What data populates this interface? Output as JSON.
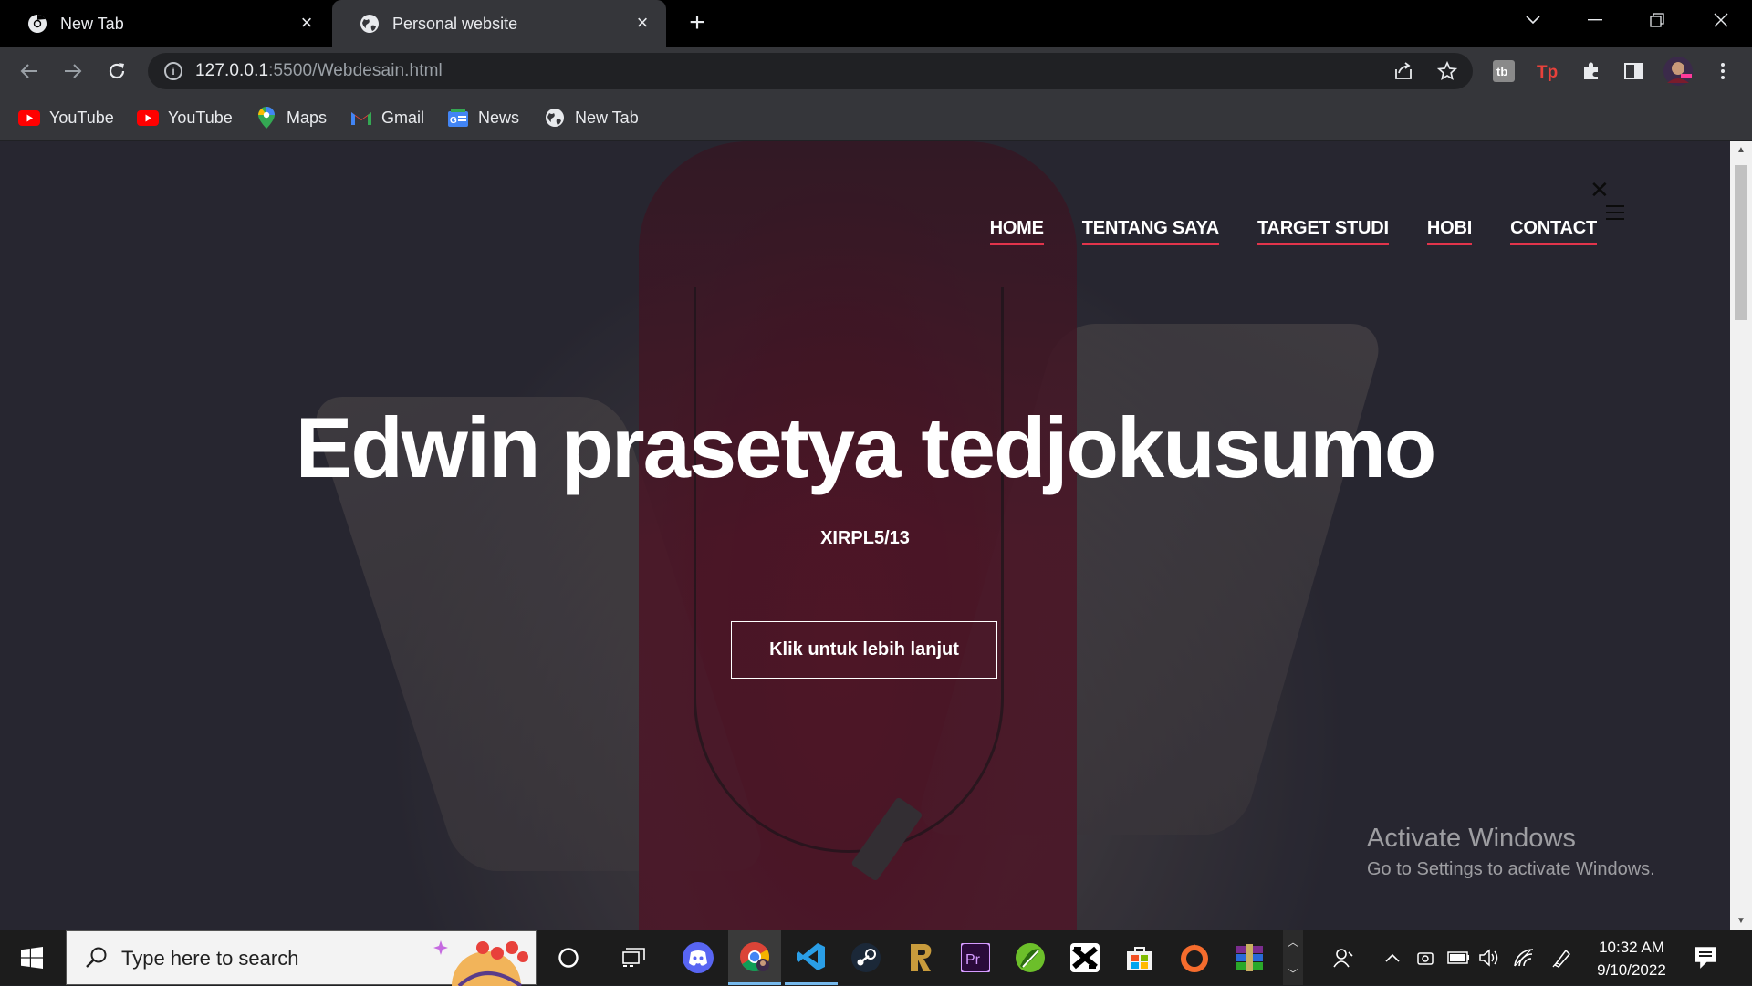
{
  "browser": {
    "tabs": [
      {
        "title": "New Tab",
        "active": false
      },
      {
        "title": "Personal website",
        "active": true
      }
    ],
    "url_host": "127.0.0.1",
    "url_rest": ":5500/Webdesain.html",
    "bookmarks": [
      "YouTube",
      "YouTube",
      "Maps",
      "Gmail",
      "News",
      "New Tab"
    ]
  },
  "site": {
    "nav": [
      "HOME",
      "TENTANG SAYA",
      "TARGET STUDI",
      "HOBI",
      "CONTACT"
    ],
    "close_glyph": "✕",
    "hero_title": "Edwin prasetya tedjokusumo",
    "hero_subtitle": "XIRPL5/13",
    "cta_label": "Klik untuk lebih lanjut"
  },
  "watermark": {
    "line1": "Activate Windows",
    "line2": "Go to Settings to activate Windows."
  },
  "taskbar": {
    "search_placeholder": "Type here to search",
    "time": "10:32 AM",
    "date": "9/10/2022"
  },
  "colors": {
    "nav_underline": "#e2344b",
    "tab_active_bg": "#35363a",
    "taskbar_bg": "#1c1c1c"
  }
}
